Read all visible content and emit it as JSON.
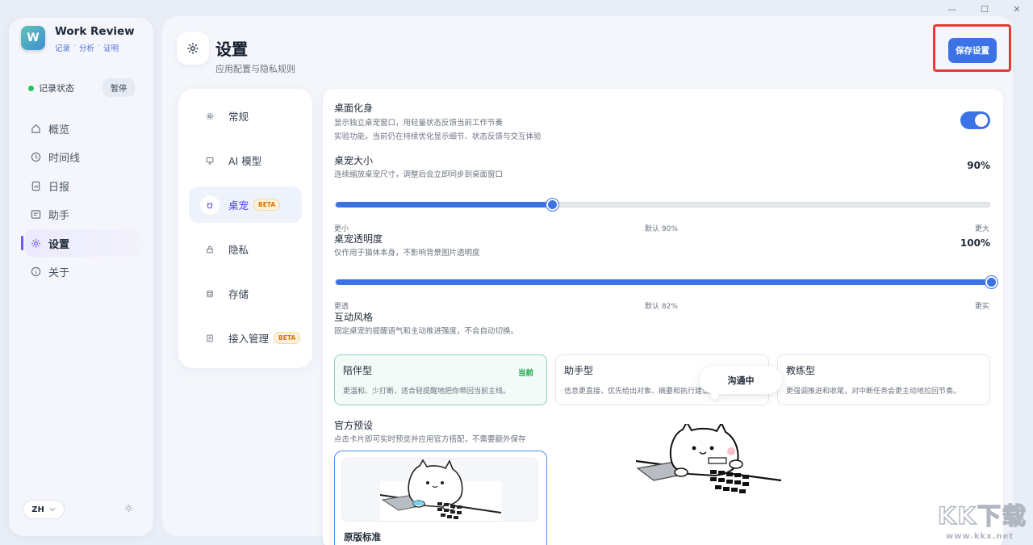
{
  "window": {
    "minimize": "—",
    "maximize": "☐",
    "close": "✕"
  },
  "app": {
    "title": "Work Review",
    "sub": [
      "记录",
      "分析",
      "证明"
    ],
    "logo_text": "W"
  },
  "status": {
    "label": "记录状态",
    "pause": "暂停"
  },
  "nav": [
    {
      "label": "概览",
      "icon": "home-icon"
    },
    {
      "label": "时间线",
      "icon": "clock-icon"
    },
    {
      "label": "日报",
      "icon": "report-icon"
    },
    {
      "label": "助手",
      "icon": "assistant-icon"
    },
    {
      "label": "设置",
      "icon": "gear-icon",
      "active": true
    },
    {
      "label": "关于",
      "icon": "info-icon"
    }
  ],
  "footer": {
    "lang": "ZH"
  },
  "header": {
    "title": "设置",
    "subtitle": "应用配置与隐私规则",
    "save": "保存设置"
  },
  "subnav": [
    {
      "label": "常规",
      "icon": "gear-icon"
    },
    {
      "label": "AI 模型",
      "icon": "monitor-icon"
    },
    {
      "label": "桌宠",
      "icon": "pet-icon",
      "beta": "BETA",
      "active": true
    },
    {
      "label": "隐私",
      "icon": "lock-icon"
    },
    {
      "label": "存储",
      "icon": "database-icon"
    },
    {
      "label": "接入管理",
      "icon": "plug-icon",
      "beta": "BETA"
    }
  ],
  "avatar": {
    "title": "桌面化身",
    "desc1": "显示独立桌宠窗口，用轻量状态反馈当前工作节奏",
    "desc2": "实验功能，当前仍在持续优化显示细节、状态反馈与交互体验",
    "enabled": true
  },
  "size": {
    "title": "桌宠大小",
    "desc": "连续缩放桌宠尺寸，调整后会立即同步到桌面窗口",
    "value": "90%",
    "fraction": 0.33,
    "min": "更小",
    "default": "默认 90%",
    "max": "更大"
  },
  "opacity": {
    "title": "桌宠透明度",
    "desc": "仅作用于猫体本身，不影响背景图片透明度",
    "value": "100%",
    "fraction": 1.0,
    "min": "更透",
    "default": "默认 82%",
    "max": "更实"
  },
  "style": {
    "title": "互动风格",
    "desc": "固定桌宠的提醒语气和主动推进强度，不会自动切换。",
    "cards": [
      {
        "title": "陪伴型",
        "desc": "更温和、少打断，适合轻提醒地把你带回当前主线。",
        "current": "当前"
      },
      {
        "title": "助手型",
        "desc": "信息更直接，优先给出对象、摘要和执行建议。"
      },
      {
        "title": "教练型",
        "desc": "更强调推进和收尾，对中断任务会更主动地拉回节奏。"
      }
    ],
    "bubble": "沟通中"
  },
  "presets": {
    "title": "官方预设",
    "desc": "点击卡片即可实时预览并应用官方搭配，不需要额外保存",
    "items": [
      {
        "name": "原版标准"
      }
    ]
  },
  "watermark": {
    "text": "KK下载",
    "url": "www.kkx.net"
  }
}
